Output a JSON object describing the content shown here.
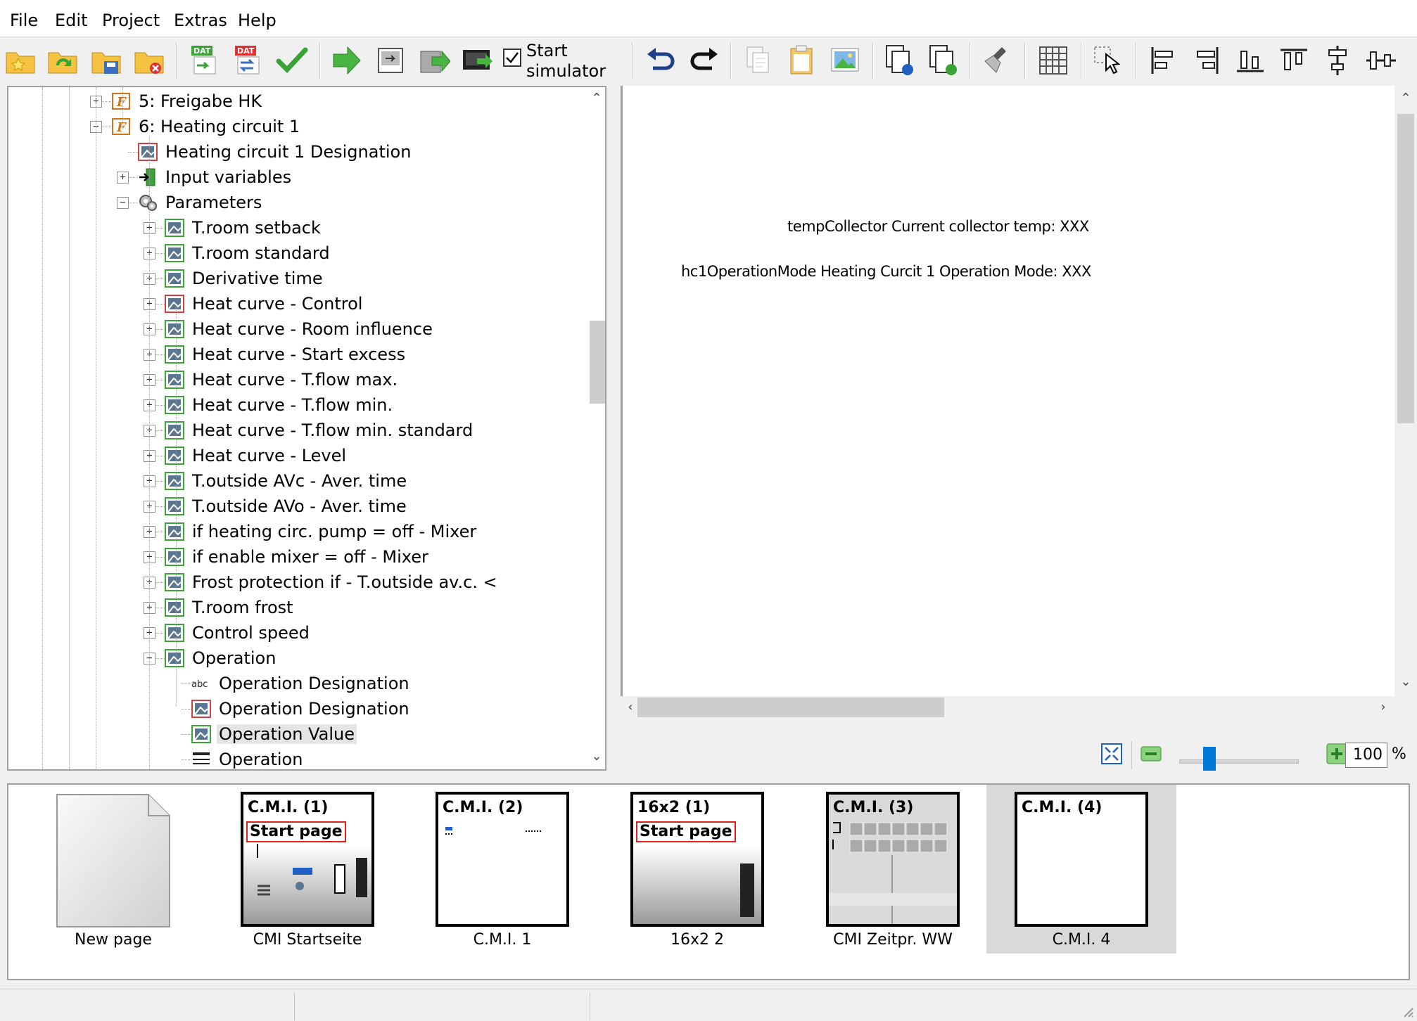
{
  "menu": [
    "File",
    "Edit",
    "Project",
    "Extras",
    "Help"
  ],
  "toolbar": {
    "simulator_label_line1": "Start",
    "simulator_label_line2": "simulator",
    "simulator_checked": true
  },
  "tree": {
    "items": [
      {
        "label": "5: Freigabe HK",
        "icon": "function-icon",
        "expander": "+"
      },
      {
        "label": "6: Heating circuit 1",
        "icon": "function-icon",
        "expander": "-"
      },
      {
        "label": "Heating circuit 1 Designation",
        "icon": "designation-red-icon",
        "expander": ""
      },
      {
        "label": "Input variables",
        "icon": "input-variables-icon",
        "expander": "+"
      },
      {
        "label": "Parameters",
        "icon": "parameters-gear-icon",
        "expander": "-"
      },
      {
        "label": "T.room setback",
        "icon": "value-icon",
        "expander": "+"
      },
      {
        "label": "T.room standard",
        "icon": "value-icon",
        "expander": "+"
      },
      {
        "label": "Derivative time",
        "icon": "value-icon",
        "expander": "+"
      },
      {
        "label": "Heat curve - Control",
        "icon": "designation-red-icon",
        "expander": "+"
      },
      {
        "label": "Heat curve - Room influence",
        "icon": "value-icon",
        "expander": "+"
      },
      {
        "label": "Heat curve - Start excess",
        "icon": "value-icon",
        "expander": "+"
      },
      {
        "label": "Heat curve - T.flow max.",
        "icon": "value-icon",
        "expander": "+"
      },
      {
        "label": "Heat curve - T.flow min.",
        "icon": "value-icon",
        "expander": "+"
      },
      {
        "label": "Heat curve - T.flow min. standard",
        "icon": "value-icon",
        "expander": "+"
      },
      {
        "label": "Heat curve - Level",
        "icon": "value-icon",
        "expander": "+"
      },
      {
        "label": "T.outside AVc - Aver. time",
        "icon": "value-icon",
        "expander": "+"
      },
      {
        "label": "T.outside AVo - Aver. time",
        "icon": "value-icon",
        "expander": "+"
      },
      {
        "label": "if heating circ. pump = off - Mixer",
        "icon": "value-icon",
        "expander": "+"
      },
      {
        "label": "if enable mixer = off - Mixer",
        "icon": "value-icon",
        "expander": "+"
      },
      {
        "label": "Frost protection if - T.outside av.c. <",
        "icon": "value-icon",
        "expander": "+"
      },
      {
        "label": "T.room frost",
        "icon": "value-icon",
        "expander": "+"
      },
      {
        "label": "Control speed",
        "icon": "value-icon",
        "expander": "+"
      },
      {
        "label": "Operation",
        "icon": "value-icon",
        "expander": "-"
      },
      {
        "label": "Operation Designation",
        "icon": "abc-text-icon",
        "expander": ""
      },
      {
        "label": "Operation Designation",
        "icon": "designation-red-icon",
        "expander": ""
      },
      {
        "label": "Operation Value",
        "icon": "value-icon",
        "expander": "",
        "selected": true
      },
      {
        "label": "Operation",
        "icon": "list-icon",
        "expander": ""
      }
    ]
  },
  "canvas": {
    "line1": "tempCollector Current collector temp: XXX",
    "line2": "hc1OperationMode Heating Curcit 1 Operation Mode: XXX"
  },
  "zoom": {
    "value": "100",
    "unit": "%"
  },
  "pages": [
    {
      "label": "New page",
      "title": "",
      "subtitle": "",
      "kind": "new"
    },
    {
      "label": "CMI Startseite",
      "title": "C.M.I. (1)",
      "subtitle": "Start page",
      "kind": "cmi1"
    },
    {
      "label": "C.M.I. 1",
      "title": "C.M.I. (2)",
      "subtitle": "",
      "kind": "blank"
    },
    {
      "label": "16x2 2",
      "title": "16x2 (1)",
      "subtitle": "Start page",
      "kind": "16x2"
    },
    {
      "label": "CMI Zeitpr. WW",
      "title": "C.M.I. (3)",
      "subtitle": "",
      "kind": "timer"
    },
    {
      "label": "C.M.I. 4",
      "title": "C.M.I. (4)",
      "subtitle": "",
      "kind": "blank",
      "selected": true
    }
  ],
  "colors": {
    "accent": "#0078d7",
    "start_page_border": "#e02020",
    "selection_bg": "#d9d9d9"
  }
}
